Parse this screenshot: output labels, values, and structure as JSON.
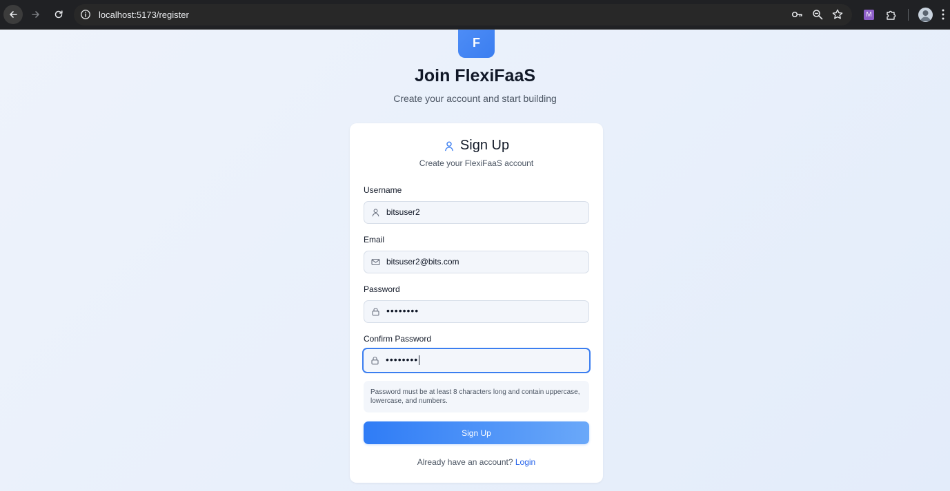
{
  "browser": {
    "url": "localhost:5173/register"
  },
  "brand": {
    "logo_letter": "F",
    "title": "Join FlexiFaaS",
    "subtitle": "Create your account and start building"
  },
  "card": {
    "title": "Sign Up",
    "subtitle": "Create your FlexiFaaS account"
  },
  "form": {
    "username": {
      "label": "Username",
      "value": "bitsuser2"
    },
    "email": {
      "label": "Email",
      "value": "bitsuser2@bits.com"
    },
    "password": {
      "label": "Password",
      "value": "••••••••"
    },
    "confirm_password": {
      "label": "Confirm Password",
      "value": "••••••••"
    },
    "hint": "Password must be at least 8 characters long and contain uppercase, lowercase, and numbers.",
    "submit_label": "Sign Up",
    "footer_text": "Already have an account?",
    "login_link": "Login"
  },
  "colors": {
    "accent": "#3b7ef0",
    "link": "#2563eb"
  }
}
